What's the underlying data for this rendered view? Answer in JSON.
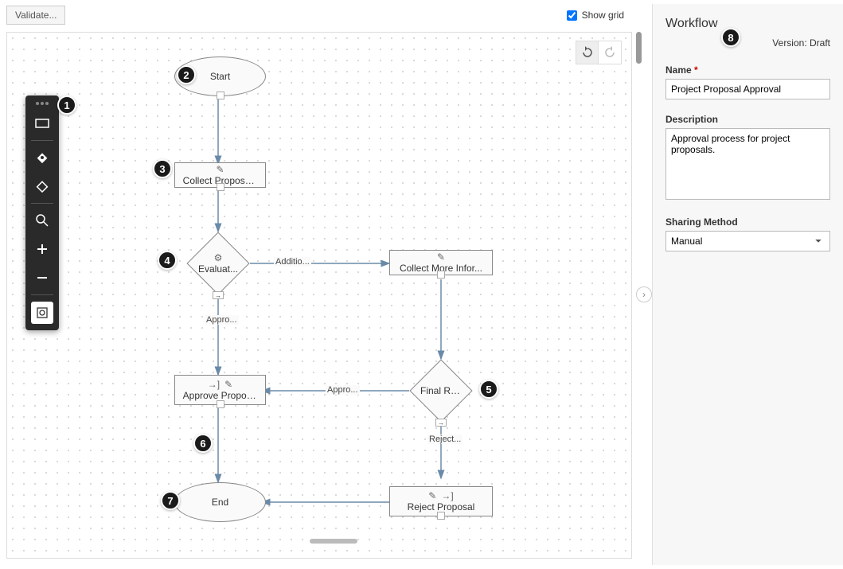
{
  "topBar": {
    "validateLabel": "Validate...",
    "showGridLabel": "Show grid",
    "showGridChecked": true
  },
  "nodes": {
    "start": {
      "label": "Start"
    },
    "collectProposal": {
      "label": "Collect Proposal I..."
    },
    "evaluate": {
      "label": "Evaluat..."
    },
    "collectMore": {
      "label": "Collect More Infor..."
    },
    "approve": {
      "label": "Approve Proposal"
    },
    "finalReview": {
      "label": "Final Re..."
    },
    "end": {
      "label": "End"
    },
    "reject": {
      "label": "Reject Proposal"
    }
  },
  "edges": {
    "additional": "Additio...",
    "approve1": "Appro...",
    "approve2": "Appro...",
    "reject": "Reject..."
  },
  "panel": {
    "title": "Workflow",
    "versionLabel": "Version: Draft",
    "nameLabel": "Name",
    "nameValue": "Project Proposal Approval",
    "descriptionLabel": "Description",
    "descriptionValue": "Approval process for project proposals.",
    "sharingLabel": "Sharing Method",
    "sharingValue": "Manual"
  },
  "callouts": [
    "1",
    "2",
    "3",
    "4",
    "5",
    "6",
    "7",
    "8"
  ]
}
